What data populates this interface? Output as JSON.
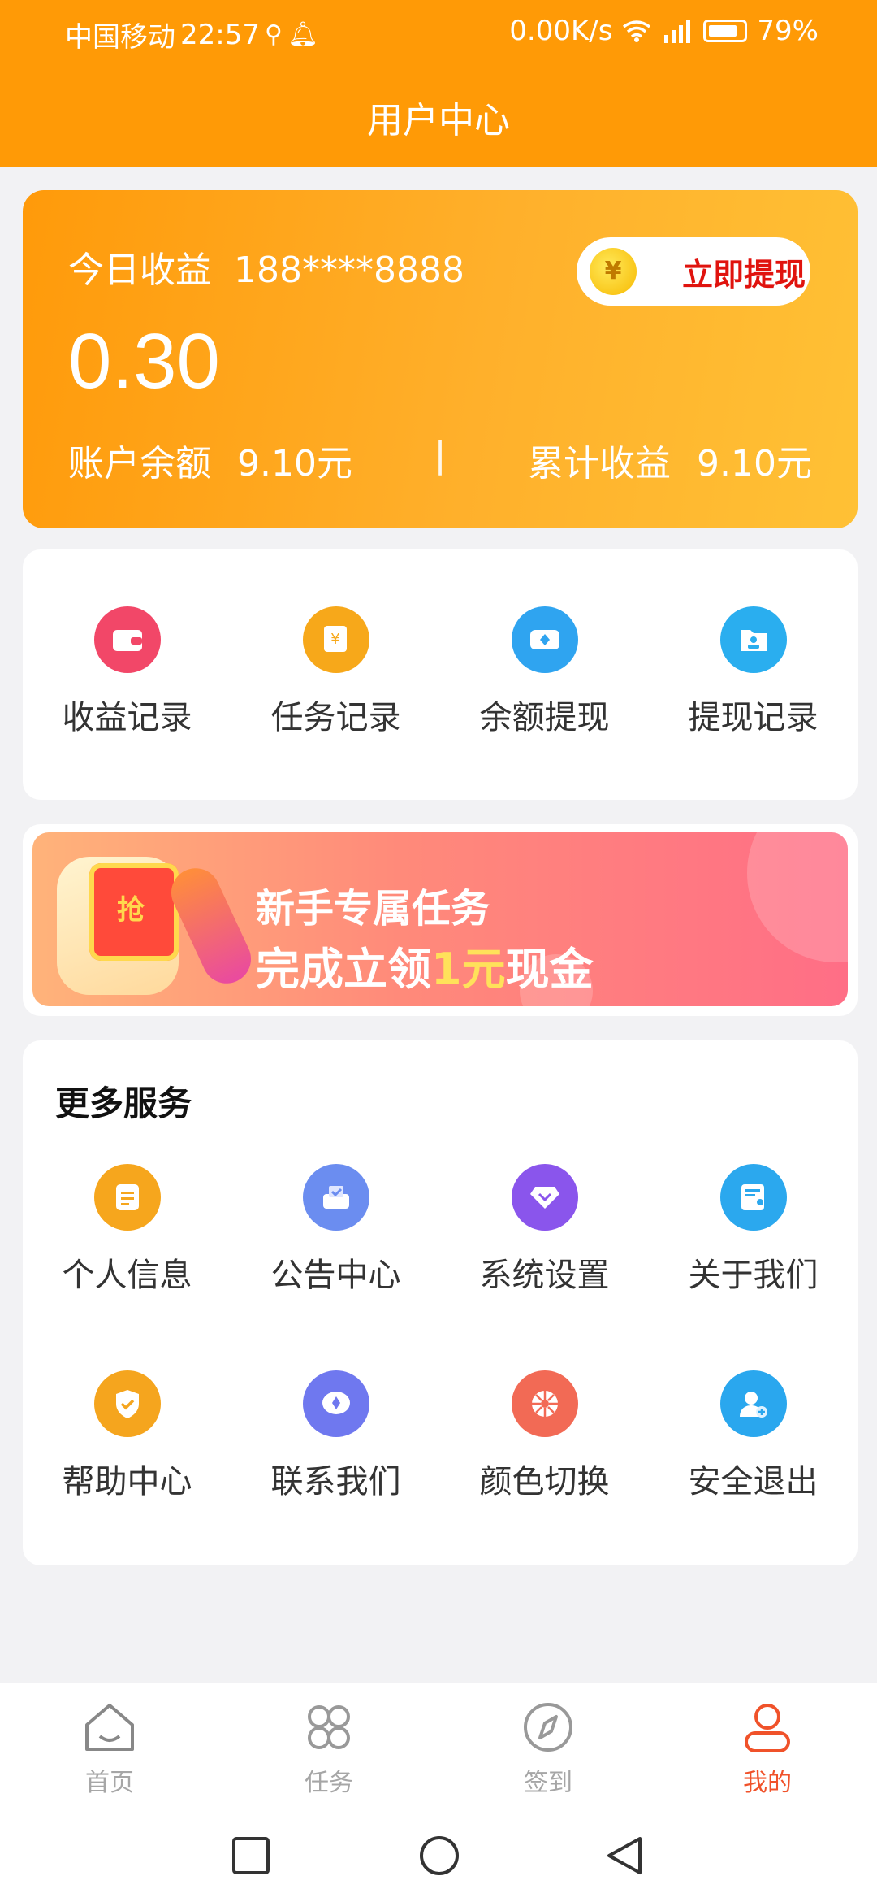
{
  "status_bar": {
    "carrier": "中国移动",
    "time": "22:57",
    "speed": "0.00K/s",
    "battery": "79%"
  },
  "header": {
    "title": "用户中心"
  },
  "earnings": {
    "today_label": "今日收益",
    "phone": "188****8888",
    "amount": "0.30",
    "balance_label": "账户余额",
    "balance_value": "9.10元",
    "separator": "|",
    "total_label": "累计收益",
    "total_value": "9.10元",
    "withdraw_button": "立即提现",
    "coin_symbol": "¥"
  },
  "quick_actions": [
    {
      "label": "收益记录",
      "icon": "wallet-icon",
      "color": "#f24768"
    },
    {
      "label": "任务记录",
      "icon": "yuan-note-icon",
      "color": "#f7a81a"
    },
    {
      "label": "余额提现",
      "icon": "diamond-card-icon",
      "color": "#2fa4f0"
    },
    {
      "label": "提现记录",
      "icon": "folder-user-icon",
      "color": "#2aaeef"
    }
  ],
  "banner": {
    "line1": "新手专属任务",
    "line2_pre": "完成立领",
    "line2_highlight": "1元",
    "line2_post": "现金",
    "envelope_text": "抢"
  },
  "more_services": {
    "title": "更多服务",
    "items": [
      {
        "label": "个人信息",
        "icon": "document-icon",
        "color": "#f6a61d"
      },
      {
        "label": "公告中心",
        "icon": "inbox-icon",
        "color": "#6b8df0"
      },
      {
        "label": "系统设置",
        "icon": "diamond-icon",
        "color": "#8a55ec"
      },
      {
        "label": "关于我们",
        "icon": "id-card-icon",
        "color": "#2ba8ee"
      },
      {
        "label": "帮助中心",
        "icon": "shield-check-icon",
        "color": "#f5a51e"
      },
      {
        "label": "联系我们",
        "icon": "chat-icon",
        "color": "#6f78ef"
      },
      {
        "label": "颜色切换",
        "icon": "palette-wheel-icon",
        "color": "#f26a55"
      },
      {
        "label": "安全退出",
        "icon": "user-add-icon",
        "color": "#2aa7ee"
      }
    ]
  },
  "tabbar": [
    {
      "label": "首页",
      "icon": "home-icon",
      "active": false
    },
    {
      "label": "任务",
      "icon": "grid-icon",
      "active": false
    },
    {
      "label": "签到",
      "icon": "compass-icon",
      "active": false
    },
    {
      "label": "我的",
      "icon": "user-icon",
      "active": true
    }
  ],
  "colors": {
    "brand": "#ff9a06",
    "accent_red": "#e0130e",
    "tab_active": "#f0522a"
  }
}
